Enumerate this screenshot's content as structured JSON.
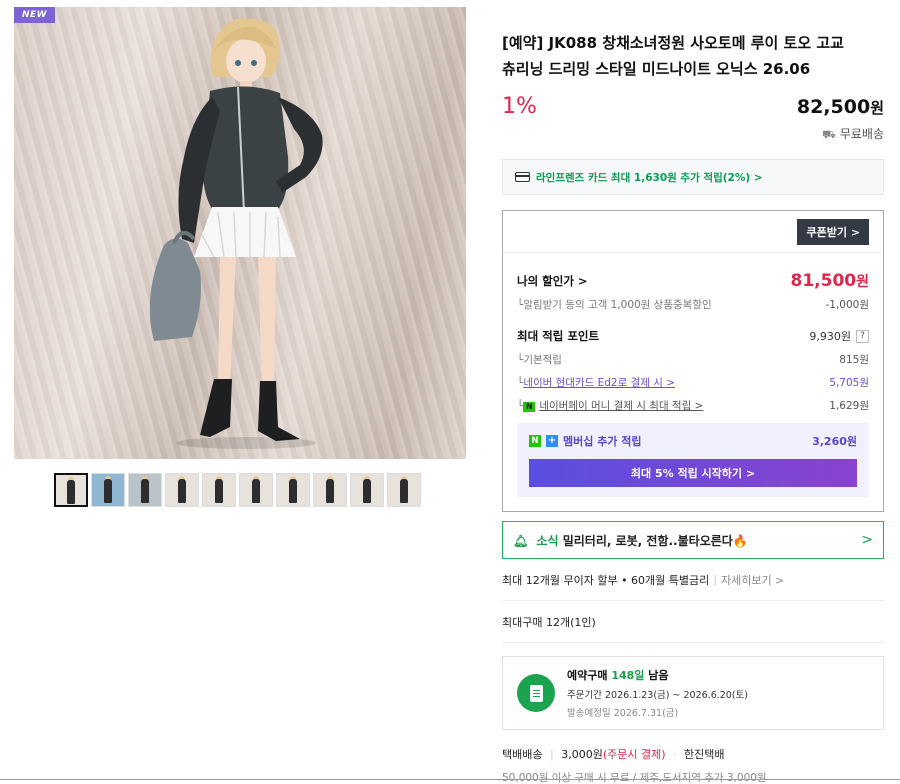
{
  "gallery": {
    "badge": "NEW",
    "thumbnail_count": 10
  },
  "product": {
    "title": "[예약] JK088 창채소녀정원 사오토메 루이 토오 고교 츄리닝 드리밍 스타일 미드나이트 오닉스 26.06",
    "discount_rate": "1%",
    "price": "82,500",
    "currency": "원",
    "shipping_badge": "무료배송"
  },
  "card_promo": {
    "text": "라인프렌즈 카드 최대 1,630원 추가 적립(2%) >"
  },
  "benefit": {
    "coupon_button": "쿠폰받기 >",
    "my_price_label": "나의 할인가 >",
    "my_price": "81,500",
    "my_price_unit": "원",
    "alert_discount_label": "알림받기 동의 고객 1,000원 상품중복할인",
    "alert_discount_value": "-1,000원",
    "max_points_label": "최대 적립 포인트",
    "max_points_value": "9,930원",
    "help_label": "?",
    "basic_label": "기본적립",
    "basic_value": "815원",
    "card_label": "네이버 현대카드 Ed2로 결제 시 >",
    "card_value": "5,705원",
    "npay_badge": "N",
    "npay_label": "네이버페이 머니 결제 시 최대 적립 >",
    "npay_value": "1,629원",
    "membership_badge_n": "N",
    "membership_badge_plus": "+",
    "membership_label": "멤버십 추가 적립",
    "membership_value": "3,260원",
    "membership_button": "최대 5% 적립 시작하기 >"
  },
  "news": {
    "prefix": "소식",
    "text": "밀리터리, 로봇, 전함..불타오른다🔥",
    "chevron": ">"
  },
  "installment": {
    "text": "최대 12개월 무이자 할부 • 60개월 특별금리",
    "more": "자세히보기 >"
  },
  "max_purchase": "최대구매 12개(1인)",
  "reservation": {
    "title_prefix": "예약구매",
    "days": "148일",
    "title_suffix": "남음",
    "order_period_label": "주문기간",
    "order_period": "2026.1.23(금) ~ 2026.6.20(토)",
    "ship_date_label": "발송예정일",
    "ship_date": "2026.7.31(금)"
  },
  "delivery": {
    "type": "택배배송",
    "fee": "3,000원",
    "fee_note": "(주문시 결제)",
    "carrier": "한진택배",
    "note": "50,000원 이상 구매 시 무료 / 제주,도서지역 추가 3,000원"
  }
}
